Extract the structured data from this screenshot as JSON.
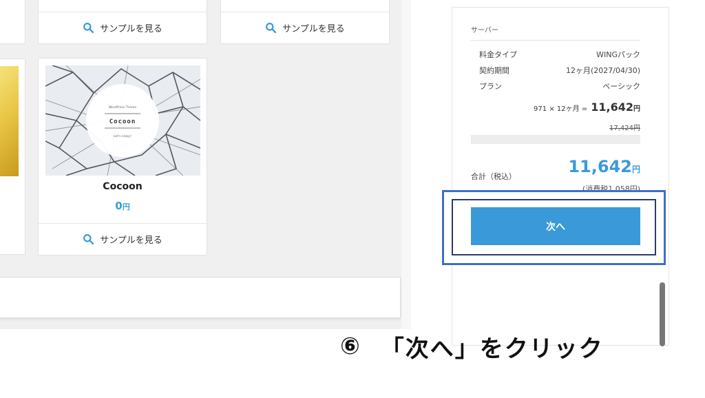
{
  "cards": {
    "top_left_sample": "サンプルを見る",
    "top_right_sample": "サンプルを見る",
    "cocoon": {
      "image_caption_small": "WordPress Theme",
      "image_title": "Cocoon",
      "image_tagline": "Let's enjoy!",
      "name": "Cocoon",
      "price_value": "0",
      "price_unit": "円",
      "sample": "サンプルを見る"
    }
  },
  "order_panel": {
    "section_title": "サーバー",
    "rows": [
      {
        "label": "料金タイプ",
        "value": "WINGパック"
      },
      {
        "label": "契約期間",
        "value": "12ヶ月(2027/04/30)"
      },
      {
        "label": "プラン",
        "value": "ベーシック"
      }
    ],
    "calc_prefix": "971 × 12ヶ月 =",
    "calc_total": "11,642",
    "calc_unit": "円",
    "original_price": "17,424円",
    "total_label": "合計（税込）",
    "total_value": "11,642",
    "total_unit": "円",
    "tax_note": "(消費税1,058円)",
    "next_button": "次へ"
  },
  "instruction": {
    "step": "⑥",
    "text": "「次へ」をクリック"
  },
  "colors": {
    "accent": "#3a9ad9",
    "highlight_border": "#3d6ec9"
  }
}
